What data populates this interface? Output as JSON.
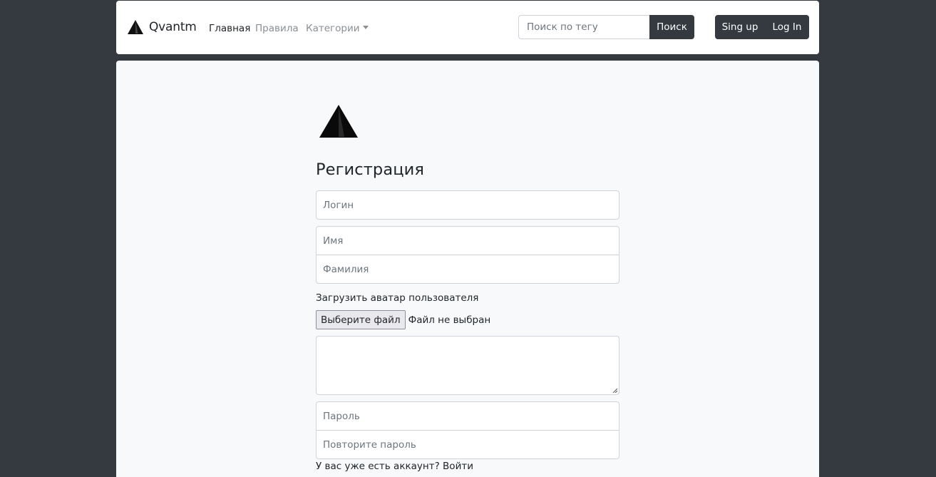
{
  "navbar": {
    "brand": "Qvantm",
    "brand_icon": "triangle-logo-icon",
    "links": [
      {
        "label": "Главная",
        "active": true
      },
      {
        "label": "Правила",
        "active": false
      },
      {
        "label": "Категории",
        "active": false,
        "dropdown": true
      }
    ],
    "search": {
      "placeholder": "Поиск по тегу",
      "button": "Поиск"
    },
    "auth": {
      "signup": "Sing up",
      "login": "Log In"
    }
  },
  "form": {
    "logo_icon": "triangle-logo-icon",
    "title": "Регистрация",
    "login_placeholder": "Логин",
    "first_name_placeholder": "Имя",
    "last_name_placeholder": "Фамилия",
    "avatar_label": "Загрузить аватар пользователя",
    "file_button": "Выберите файл",
    "file_status": "Файл не выбран",
    "password_placeholder": "Пароль",
    "repeat_password_placeholder": "Повторите пароль",
    "have_account": "У вас уже есть аккаунт?",
    "login_link": "Войти"
  },
  "colors": {
    "page_bg": "#343a40",
    "panel_bg": "#f8f9fa",
    "dark_button": "#343a40"
  }
}
